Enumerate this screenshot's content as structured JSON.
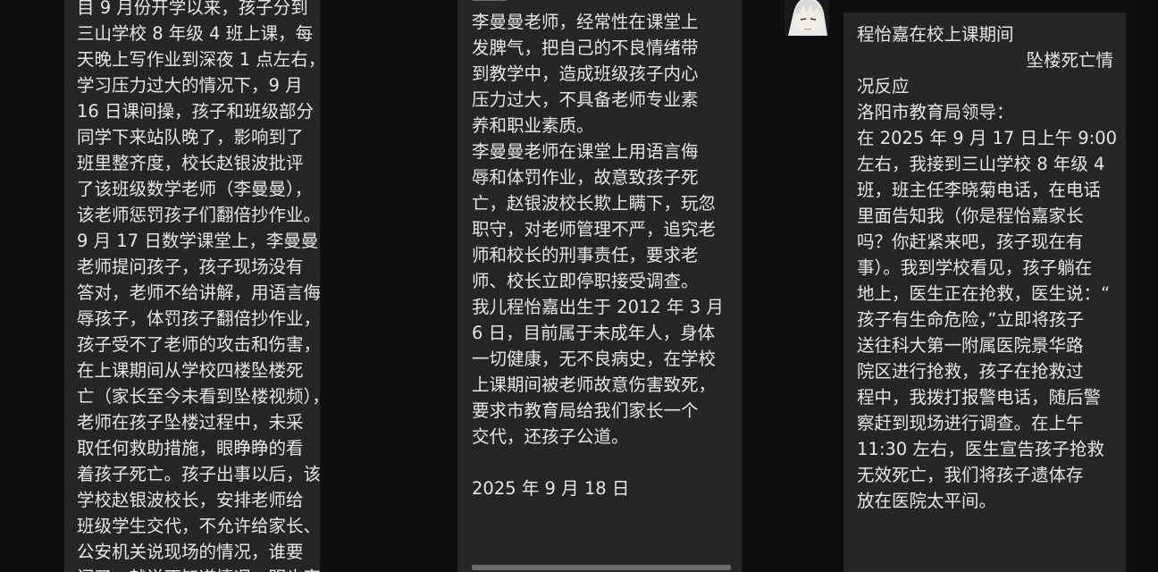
{
  "chat": {
    "left_bubble": {
      "lines": [
        "目 9 月份开学以来，孩子分到",
        "三山学校 8 年级 4 班上课，每",
        "天晚上写作业到深夜 1 点左右，",
        "学习压力过大的情况下，9 月",
        "16 日课间操，孩子和班级部分",
        "同学下来站队晚了，影响到了",
        "班里整齐度，校长赵银波批评",
        "了该班级数学老师（李曼曼），",
        "该老师惩罚孩子们翻倍抄作业。",
        "9 月 17 日数学课堂上，李曼曼",
        "老师提问孩子，孩子现场没有",
        "答对，老师不给讲解，用语言侮",
        "辱孩子，体罚孩子翻倍抄作业，",
        "孩子受不了老师的攻击和伤害，",
        "在上课期间从学校四楼坠楼死",
        "亡（家长至今未看到坠楼视频），",
        "老师在孩子坠楼过程中，未采",
        "取任何救助措施，眼睁睁的看",
        "着孩子死亡。孩子出事以后，该",
        "学校赵银波校长，安排老师给",
        "班级学生交代，不允许给家长、",
        "公安机关说现场的情况，谁要",
        "问了，就说不知道情况，明也家"
      ]
    },
    "middle_bubble": {
      "lines": [
        "李曼曼老师，经常性在课堂上",
        "发脾气，把自己的不良情绪带",
        "到教学中，造成班级孩子内心",
        "压力过大，不具备老师专业素",
        "养和职业素质。",
        "李曼曼老师在课堂上用语言侮",
        "辱和体罚作业，故意致孩子死",
        "亡，赵银波校长欺上瞒下，玩忽",
        "职守，对老师管理不严，追究老",
        "师和校长的刑事责任，要求老",
        "师、校长立即停职接受调查。",
        "我儿程怡嘉出生于 2012 年 3 月",
        "6 日，目前属于未成年人，身体",
        "一切健康，无不良病史，在学校",
        "上课期间被老师故意伤害致死，",
        "要求市教育局给我们家长一个",
        "交代，还孩子公道。",
        "",
        "2025 年 9 月 18 日"
      ]
    },
    "right_bubble": {
      "title_line_1": "程怡嘉在校上课期间",
      "title_line_2": "坠楼死亡情",
      "title_line_3": "况反应",
      "lines": [
        "洛阳市教育局领导：",
        "在 2025 年 9 月 17 日上午 9:00",
        "左右，我接到三山学校 8 年级 4",
        "班，班主任李晓菊电话，在电话",
        "里面告知我（你是程怡嘉家长",
        "吗？你赶紧来吧，孩子现在有",
        "事）。我到学校看见，孩子躺在",
        "地上，医生正在抢救，医生说：“",
        "孩子有生命危险，”立即将孩子",
        "送往科大第一附属医院景华路",
        "院区进行抢救，孩子在抢救过",
        "程中，我拨打报警电话，随后警",
        "察赶到现场进行调查。在上午",
        "11:30 左右，医生宣告孩子抢救",
        "无效死亡，我们将孩子遗体存",
        "放在医院太平间。"
      ]
    },
    "colors": {
      "background": "#0e0e10",
      "bubble": "#262628",
      "text": "#e6e6e6"
    }
  }
}
